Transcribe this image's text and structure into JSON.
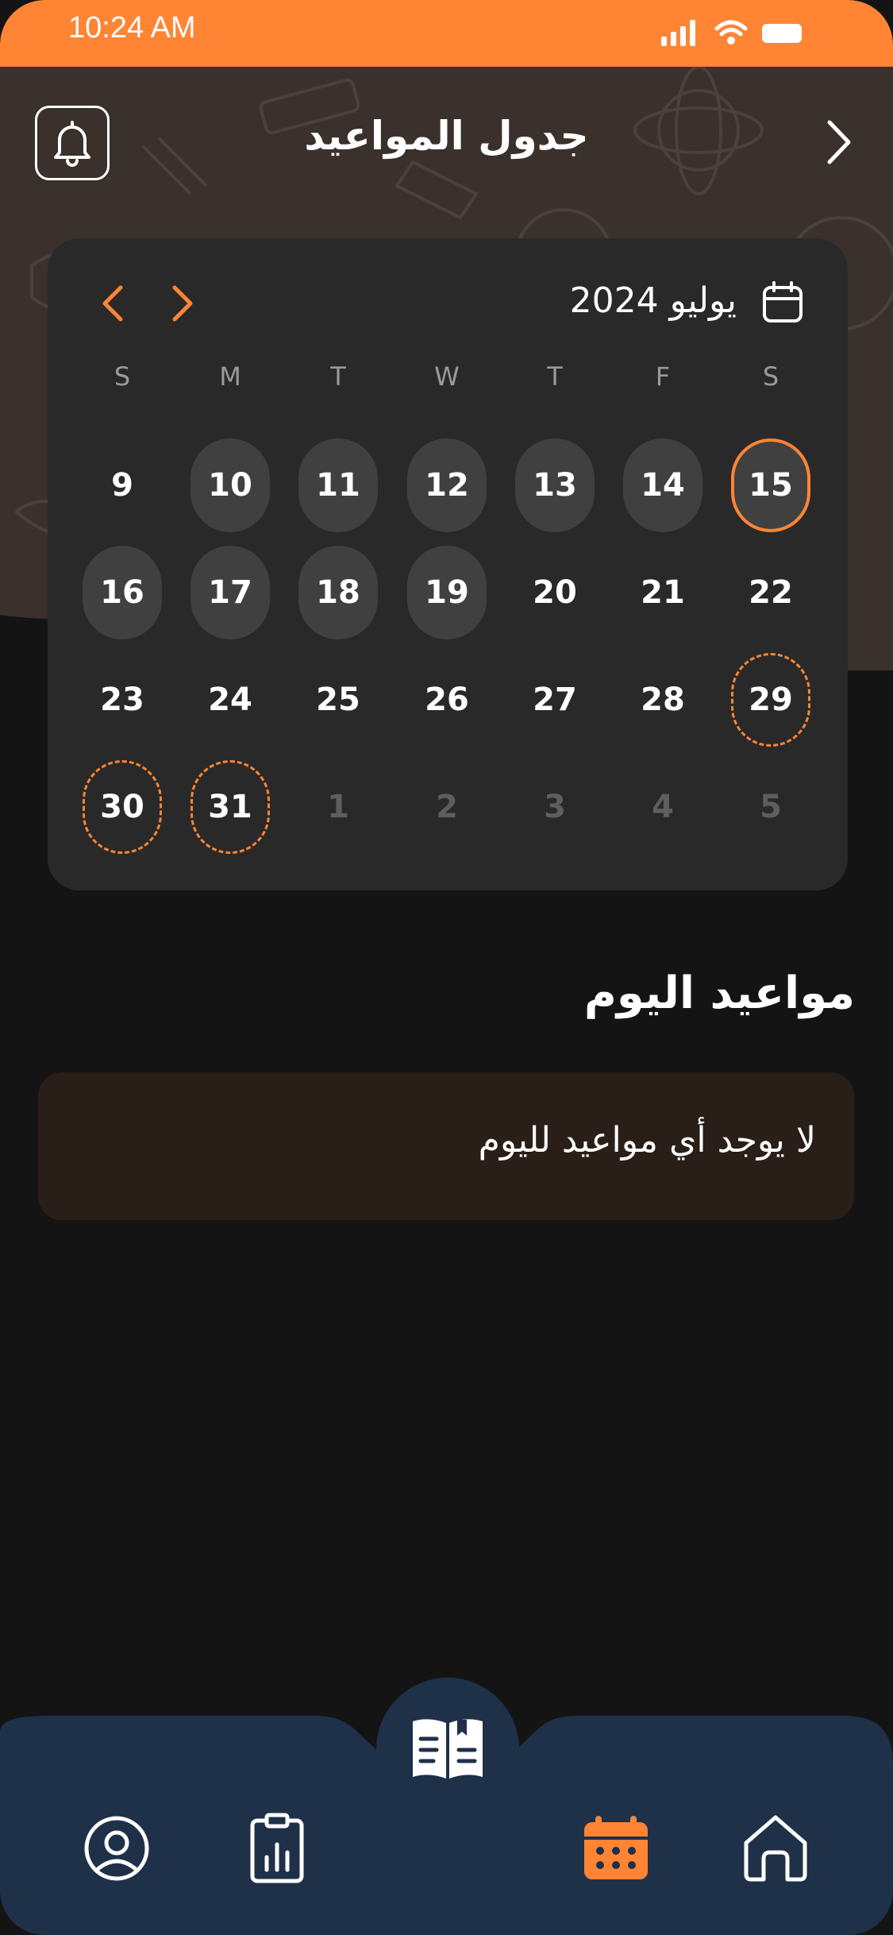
{
  "status": {
    "time": "10:24 AM"
  },
  "header": {
    "title": "جدول المواعيد"
  },
  "calendar": {
    "month_label": "يوليو 2024",
    "weekdays": [
      "S",
      "M",
      "T",
      "W",
      "T",
      "F",
      "S"
    ],
    "weeks": [
      [
        "9",
        "10",
        "11",
        "12",
        "13",
        "14",
        "15"
      ],
      [
        "16",
        "17",
        "18",
        "19",
        "20",
        "21",
        "22"
      ],
      [
        "23",
        "24",
        "25",
        "26",
        "27",
        "28",
        "29"
      ],
      [
        "30",
        "31",
        "1",
        "2",
        "3",
        "4",
        "5"
      ]
    ],
    "selected_day": "15"
  },
  "today": {
    "title": "مواعيد اليوم",
    "empty_text": "لا يوجد أي مواعيد لليوم"
  },
  "colors": {
    "accent": "#FF8534",
    "nav": "#1F3049",
    "card": "#292929",
    "background": "#141414"
  },
  "nav": {
    "items": [
      "profile-icon",
      "report-icon",
      "book-icon",
      "calendar-icon",
      "home-icon"
    ],
    "active": "calendar-icon"
  }
}
